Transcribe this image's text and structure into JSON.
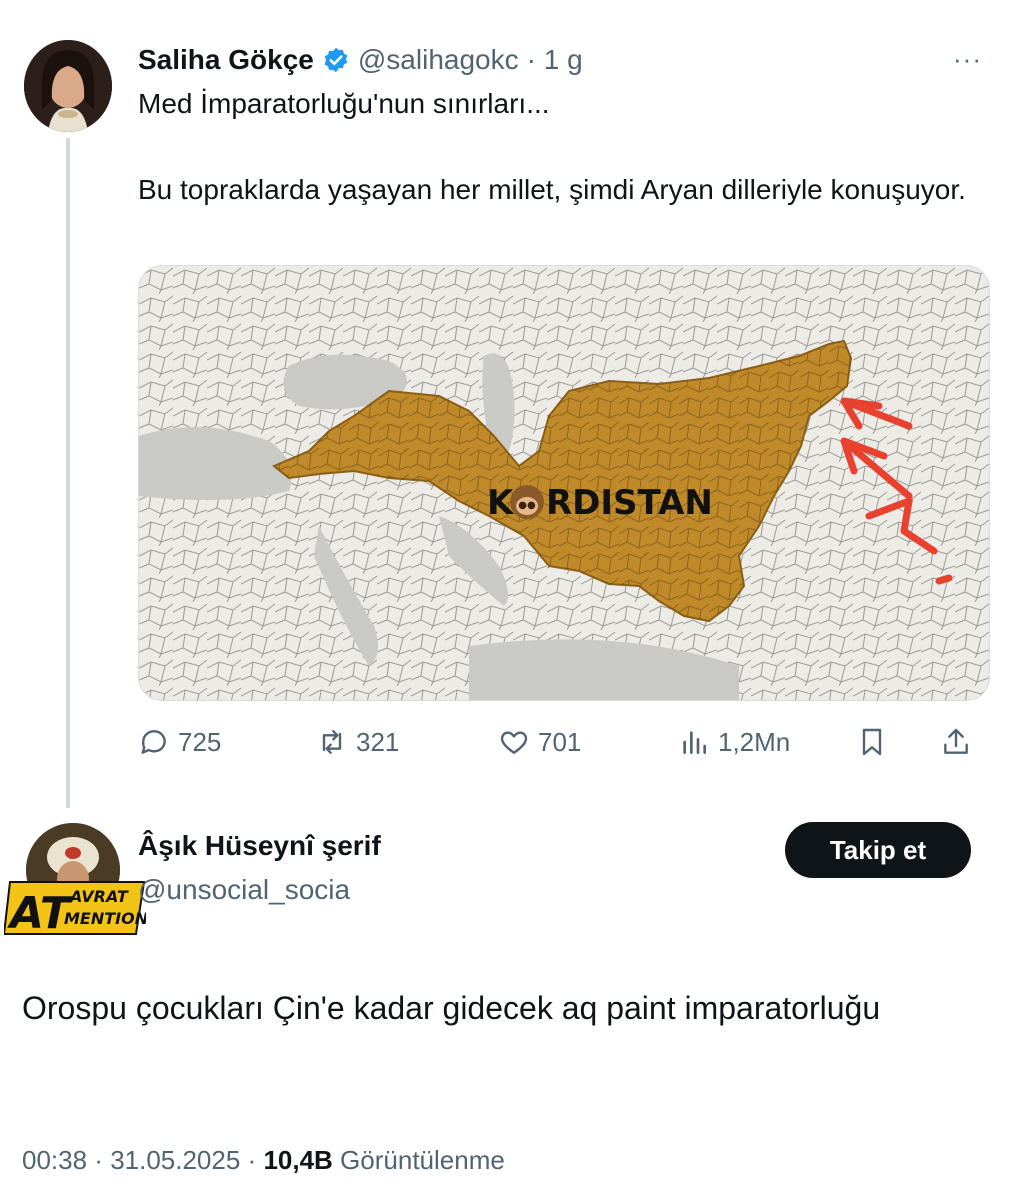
{
  "tweet": {
    "author_name": "Saliha Gökçe",
    "author_handle": "@salihagokc",
    "time": "· 1 g",
    "more": "···",
    "text_line1": "Med İmparatorluğu'nun sınırları...",
    "text_line2": " Bu topraklarda yaşayan her millet, şimdi Aryan dilleriyle konuşuyor.",
    "map_label_a": "K",
    "map_label_b": "RDISTAN",
    "map_emoji": "🙈",
    "stats": {
      "replies": "725",
      "retweets": "321",
      "likes": "701",
      "views": "1,2Mn"
    }
  },
  "reply": {
    "author_name": "Âşık Hüseynî şerif",
    "author_handle": "@unsocial_socia",
    "follow_label": "Takip et",
    "badge_big": "AT",
    "badge_top": "AVRAT",
    "badge_bottom": "MENTION",
    "text": "Orospu çocukları Çin'e kadar gidecek aq paint imparatorluğu"
  },
  "footer": {
    "time": "00:38",
    "sep1": " · ",
    "date": "31.05.2025",
    "sep2": " · ",
    "views": "10,4B",
    "views_label": " Görüntülenme"
  },
  "colors": {
    "accent": "#1d9bf0",
    "muted": "#536471",
    "empire": "#c08a2a",
    "arrow": "#e8412f"
  }
}
